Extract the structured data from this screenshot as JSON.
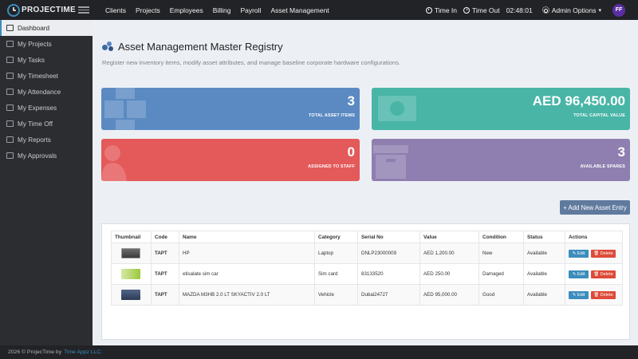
{
  "brand": {
    "name": "PROJECTIME"
  },
  "nav": [
    "Clients",
    "Projects",
    "Employees",
    "Billing",
    "Payroll",
    "Asset Management"
  ],
  "topright": {
    "time_in": "Time In",
    "time_out": "Time Out",
    "clock": "02:48:01",
    "admin": "Admin Options",
    "avatar": "FF"
  },
  "sidebar": [
    {
      "label": "Dashboard",
      "icon": "home-icon"
    },
    {
      "label": "My Projects",
      "icon": "folder-icon"
    },
    {
      "label": "My Tasks",
      "icon": "folder-icon"
    },
    {
      "label": "My Timesheet",
      "icon": "folder-icon"
    },
    {
      "label": "My Attendance",
      "icon": "folder-icon"
    },
    {
      "label": "My Expenses",
      "icon": "folder-icon"
    },
    {
      "label": "My Time Off",
      "icon": "folder-icon"
    },
    {
      "label": "My Reports",
      "icon": "folder-icon"
    },
    {
      "label": "My Approvals",
      "icon": "folder-icon"
    }
  ],
  "page": {
    "title": "Asset Management Master Registry",
    "subtitle": "Register new inventory items, modify asset attributes, and manage baseline corporate hardware configurations."
  },
  "cards": {
    "total": {
      "value": "3",
      "label": "TOTAL ASSET ITEMS"
    },
    "capital": {
      "value": "AED 96,450.00",
      "label": "TOTAL CAPITAL VALUE"
    },
    "assigned": {
      "value": "0",
      "label": "ASSIGNED TO STAFF"
    },
    "spares": {
      "value": "3",
      "label": "AVAILABLE SPARES"
    }
  },
  "add_button": "+ Add New Asset Entry",
  "table": {
    "headers": [
      "Thumbnail",
      "Code",
      "Name",
      "Category",
      "Serial No",
      "Value",
      "Condition",
      "Status",
      "Actions"
    ],
    "edit_label": "✎ Edit",
    "delete_label": "🗑 Delete",
    "rows": [
      {
        "code": "TAPT",
        "name": "HP",
        "category": "Laptop",
        "serial": "DNLP23000009",
        "value": "AED 1,200.00",
        "condition": "New",
        "status": "Available"
      },
      {
        "code": "TAPT",
        "name": "etisalate sim car",
        "category": "Sim card",
        "serial": "83133520",
        "value": "AED 250.00",
        "condition": "Damaged",
        "status": "Available"
      },
      {
        "code": "TAPT",
        "name": "MAZDA M3HB 2.0 LT SKYACTIV 2.0 LT",
        "category": "Vehicle",
        "serial": "Dubai24727",
        "value": "AED 95,000.00",
        "condition": "Good",
        "status": "Available"
      }
    ]
  },
  "footer": {
    "text": "2026 © ProjecTime by",
    "link": "Time Appz LLC."
  },
  "colors": {
    "primary": "#3c8dbc",
    "card_blue": "#5b8ac2",
    "card_teal": "#48b5a7",
    "card_red": "#e4595a",
    "card_purple": "#8f7fb0"
  }
}
